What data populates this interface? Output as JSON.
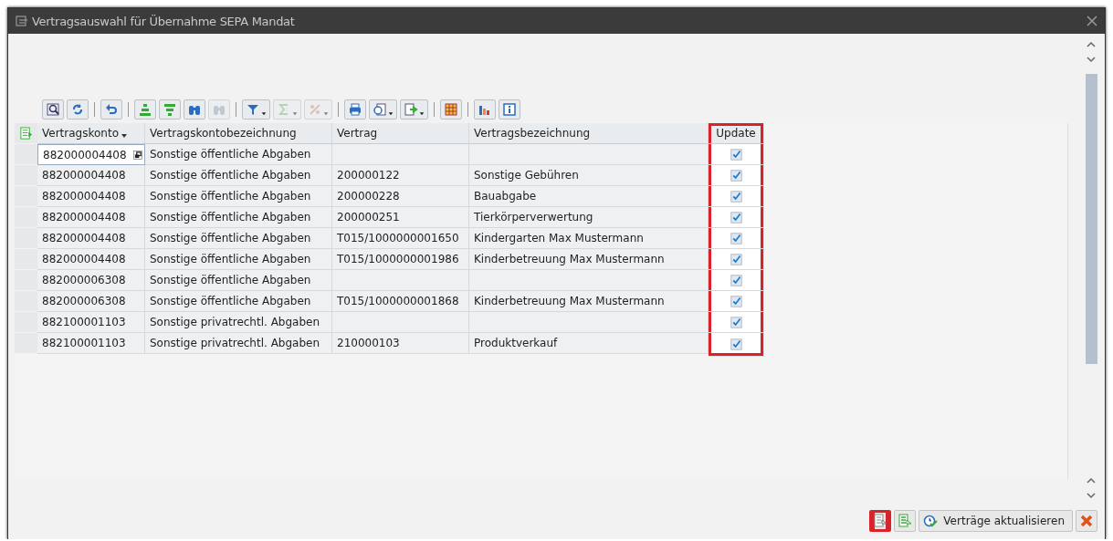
{
  "window": {
    "title": "Vertragsauswahl für Übernahme SEPA Mandat"
  },
  "toolbar": [
    {
      "kind": "details",
      "disabled": false,
      "dropdown": false
    },
    {
      "kind": "refresh",
      "disabled": false,
      "dropdown": false
    },
    {
      "kind": "undo",
      "disabled": false,
      "dropdown": false
    },
    {
      "kind": "sort-up",
      "disabled": false,
      "dropdown": false
    },
    {
      "kind": "sort-down",
      "disabled": false,
      "dropdown": false
    },
    {
      "kind": "find",
      "disabled": false,
      "dropdown": false
    },
    {
      "kind": "find-next",
      "disabled": true,
      "dropdown": false
    },
    {
      "kind": "filter",
      "disabled": false,
      "dropdown": true
    },
    {
      "kind": "sum",
      "disabled": true,
      "dropdown": true
    },
    {
      "kind": "subtotal",
      "disabled": true,
      "dropdown": true
    },
    {
      "kind": "print",
      "disabled": false,
      "dropdown": false
    },
    {
      "kind": "view",
      "disabled": false,
      "dropdown": true
    },
    {
      "kind": "export",
      "disabled": false,
      "dropdown": true
    },
    {
      "kind": "layout",
      "disabled": false,
      "dropdown": false
    },
    {
      "kind": "chart",
      "disabled": false,
      "dropdown": false
    },
    {
      "kind": "info",
      "disabled": false,
      "dropdown": false
    }
  ],
  "table": {
    "columns": [
      {
        "label": "Vertragskonto",
        "sorted": true,
        "highlighted": false
      },
      {
        "label": "Vertragskontobezeichnung",
        "sorted": false,
        "highlighted": false
      },
      {
        "label": "Vertrag",
        "sorted": false,
        "highlighted": false
      },
      {
        "label": "Vertragsbezeichnung",
        "sorted": false,
        "highlighted": false
      },
      {
        "label": "Update",
        "sorted": false,
        "highlighted": true
      }
    ],
    "rows": [
      {
        "konto": "882000004408",
        "konto_bez": "Sonstige öffentliche Abgaben",
        "focused": true,
        "update": true
      },
      {
        "konto": "882000004408",
        "konto_bez": "Sonstige öffentliche Abgaben",
        "vertrag": "200000122",
        "vertrag_bez": "Sonstige Gebühren",
        "focused": false,
        "update": true
      },
      {
        "konto": "882000004408",
        "konto_bez": "Sonstige öffentliche Abgaben",
        "vertrag": "200000228",
        "vertrag_bez": "Bauabgabe",
        "focused": false,
        "update": true
      },
      {
        "konto": "882000004408",
        "konto_bez": "Sonstige öffentliche Abgaben",
        "vertrag": "200000251",
        "vertrag_bez": "Tierkörperverwertung",
        "focused": false,
        "update": true
      },
      {
        "konto": "882000004408",
        "konto_bez": "Sonstige öffentliche Abgaben",
        "vertrag": "T015/1000000001650",
        "vertrag_bez": "Kindergarten Max Mustermann",
        "focused": false,
        "update": true
      },
      {
        "konto": "882000004408",
        "konto_bez": "Sonstige öffentliche Abgaben",
        "vertrag": "T015/1000000001986",
        "vertrag_bez": "Kinderbetreuung Max Mustermann",
        "focused": false,
        "update": true
      },
      {
        "konto": "882000006308",
        "konto_bez": "Sonstige öffentliche Abgaben",
        "focused": false,
        "update": true
      },
      {
        "konto": "882000006308",
        "konto_bez": "Sonstige öffentliche Abgaben",
        "vertrag": "T015/1000000001868",
        "vertrag_bez": "Kinderbetreuung Max Mustermann",
        "focused": false,
        "update": true
      },
      {
        "konto": "882100001103",
        "konto_bez": "Sonstige privatrechtl. Abgaben",
        "focused": false,
        "update": true
      },
      {
        "konto": "882100001103",
        "konto_bez": "Sonstige privatrechtl. Abgaben",
        "vertrag": "210000103",
        "vertrag_bez": "Produktverkauf",
        "focused": false,
        "update": true
      }
    ]
  },
  "footer": [
    {
      "kind": "select-all",
      "highlighted": true
    },
    {
      "kind": "deselect-all",
      "highlighted": false
    },
    {
      "kind": "execute",
      "label": "Verträge aktualisieren",
      "highlighted": false
    },
    {
      "kind": "cancel",
      "highlighted": false
    }
  ]
}
